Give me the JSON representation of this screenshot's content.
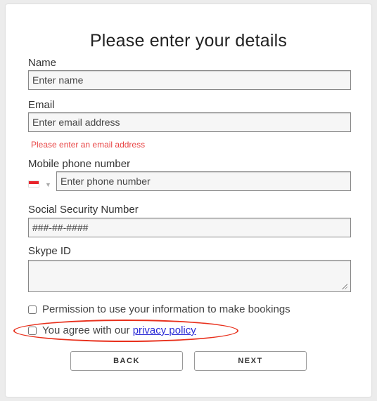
{
  "form": {
    "title": "Please enter your details",
    "name": {
      "label": "Name",
      "placeholder": "Enter name",
      "value": ""
    },
    "email": {
      "label": "Email",
      "placeholder": "Enter email address",
      "value": "",
      "error": "Please enter an email address"
    },
    "phone": {
      "label": "Mobile phone number",
      "placeholder": "Enter phone number",
      "value": "",
      "country_flag_icon": "singapore-flag-icon",
      "country_caret_icon": "caret-down-icon"
    },
    "ssn": {
      "label": "Social Security Number",
      "placeholder": "###-##-####",
      "value": ""
    },
    "skype": {
      "label": "Skype ID",
      "value": ""
    },
    "permission_checkbox": {
      "label": "Permission to use your information to make bookings",
      "checked": false
    },
    "privacy_checkbox": {
      "label_prefix": "You agree with our ",
      "link_text": "privacy policy",
      "checked": false
    },
    "buttons": {
      "back": "BACK",
      "next": "NEXT"
    }
  },
  "colors": {
    "error": "#e84545",
    "link": "#2b2bd6",
    "annotation": "#e8301c",
    "flag_red": "#e8232a"
  }
}
